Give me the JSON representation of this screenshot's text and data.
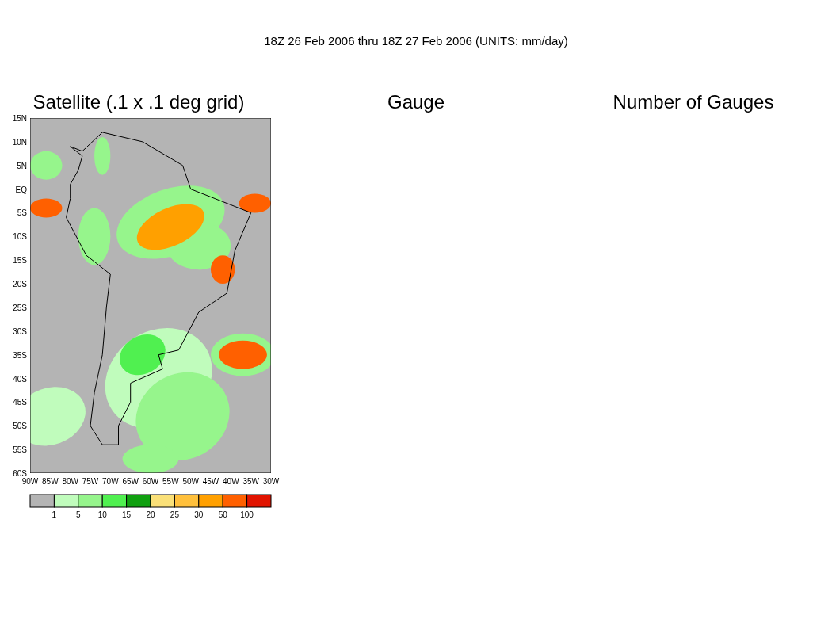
{
  "title": "18Z 26 Feb 2006 thru 18Z 27 Feb 2006 (UNITS: mm/day)",
  "panels": [
    {
      "title": "Satellite (.1 x .1 deg grid)",
      "kind": "map"
    },
    {
      "title": "Gauge",
      "kind": "empty"
    },
    {
      "title": "Number of Gauges",
      "kind": "empty"
    }
  ],
  "map": {
    "y_ticks": [
      "15N",
      "10N",
      "5N",
      "EQ",
      "5S",
      "10S",
      "15S",
      "20S",
      "25S",
      "30S",
      "35S",
      "40S",
      "45S",
      "50S",
      "55S",
      "60S"
    ],
    "x_ticks": [
      "90W",
      "85W",
      "80W",
      "75W",
      "70W",
      "65W",
      "60W",
      "55W",
      "50W",
      "45W",
      "40W",
      "35W",
      "30W"
    ]
  },
  "legend": {
    "segments": [
      {
        "color": "#b4b4b4"
      },
      {
        "color": "#c0fcbc"
      },
      {
        "color": "#96f58c"
      },
      {
        "color": "#50f050"
      },
      {
        "color": "#10a010"
      },
      {
        "color": "#fae078"
      },
      {
        "color": "#ffc03c"
      },
      {
        "color": "#ffa000"
      },
      {
        "color": "#ff6000"
      },
      {
        "color": "#e11400"
      }
    ],
    "labels": [
      "1",
      "5",
      "10",
      "15",
      "20",
      "25",
      "30",
      "50",
      "100"
    ]
  }
}
